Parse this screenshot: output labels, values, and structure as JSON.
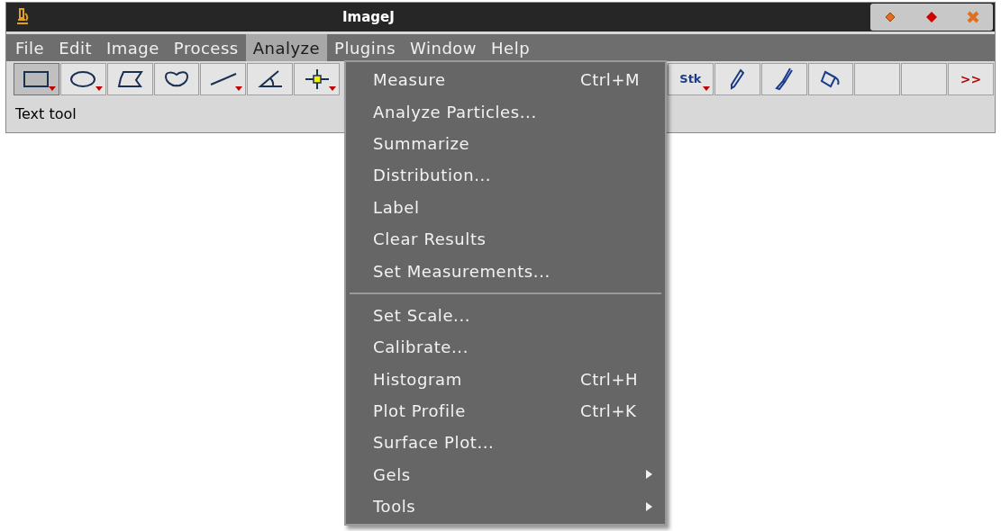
{
  "window": {
    "title": "ImageJ"
  },
  "menubar": [
    {
      "label": "File",
      "selected": false
    },
    {
      "label": "Edit",
      "selected": false
    },
    {
      "label": "Image",
      "selected": false
    },
    {
      "label": "Process",
      "selected": false
    },
    {
      "label": "Analyze",
      "selected": true
    },
    {
      "label": "Plugins",
      "selected": false
    },
    {
      "label": "Window",
      "selected": false
    },
    {
      "label": "Help",
      "selected": false
    }
  ],
  "toolbar_left": [
    {
      "kind": "rectangle",
      "selected": true,
      "dropdown": true
    },
    {
      "kind": "oval",
      "selected": false,
      "dropdown": true
    },
    {
      "kind": "polygon",
      "selected": false,
      "dropdown": false
    },
    {
      "kind": "freehand",
      "selected": false,
      "dropdown": false
    },
    {
      "kind": "line",
      "selected": false,
      "dropdown": true
    },
    {
      "kind": "angle",
      "selected": false,
      "dropdown": false
    },
    {
      "kind": "point",
      "selected": false,
      "dropdown": true
    }
  ],
  "toolbar_right": [
    {
      "kind": "text",
      "label": "Stk",
      "dropdown": true
    },
    {
      "kind": "pencil",
      "dropdown": false
    },
    {
      "kind": "brush",
      "dropdown": false
    },
    {
      "kind": "fill",
      "dropdown": false
    },
    {
      "kind": "blank",
      "dropdown": false
    },
    {
      "kind": "blank",
      "dropdown": false
    },
    {
      "kind": "more",
      "label": ">>",
      "dropdown": false
    }
  ],
  "status_bar": {
    "text": "Text tool"
  },
  "analyze_menu": [
    {
      "kind": "item",
      "label": "Measure",
      "shortcut": "Ctrl+M"
    },
    {
      "kind": "item",
      "label": "Analyze Particles..."
    },
    {
      "kind": "item",
      "label": "Summarize"
    },
    {
      "kind": "item",
      "label": "Distribution..."
    },
    {
      "kind": "item",
      "label": "Label"
    },
    {
      "kind": "item",
      "label": "Clear Results"
    },
    {
      "kind": "item",
      "label": "Set Measurements..."
    },
    {
      "kind": "separator"
    },
    {
      "kind": "item",
      "label": "Set Scale..."
    },
    {
      "kind": "item",
      "label": "Calibrate..."
    },
    {
      "kind": "item",
      "label": "Histogram",
      "shortcut": "Ctrl+H"
    },
    {
      "kind": "item",
      "label": "Plot Profile",
      "shortcut": "Ctrl+K"
    },
    {
      "kind": "item",
      "label": "Surface Plot..."
    },
    {
      "kind": "submenu",
      "label": "Gels"
    },
    {
      "kind": "submenu",
      "label": "Tools"
    }
  ]
}
